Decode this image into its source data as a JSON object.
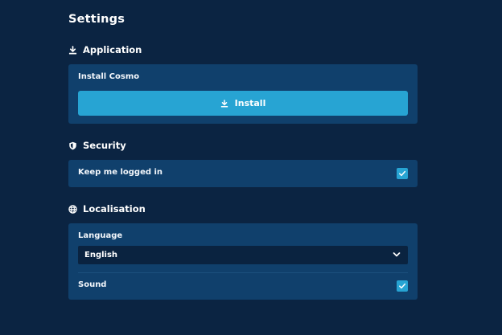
{
  "page": {
    "title": "Settings"
  },
  "application": {
    "heading": "Application",
    "icon": "download-icon",
    "install_label": "Install Cosmo",
    "install_button": "Install"
  },
  "security": {
    "heading": "Security",
    "icon": "shield-icon",
    "keep_logged_in_label": "Keep me logged in",
    "keep_logged_in_checked": true
  },
  "localisation": {
    "heading": "Localisation",
    "icon": "globe-icon",
    "language_label": "Language",
    "language_value": "English",
    "sound_label": "Sound",
    "sound_checked": true
  },
  "colors": {
    "background": "#0b2442",
    "card": "#10406c",
    "accent": "#27a4d3",
    "select_bg": "#0a2340"
  }
}
